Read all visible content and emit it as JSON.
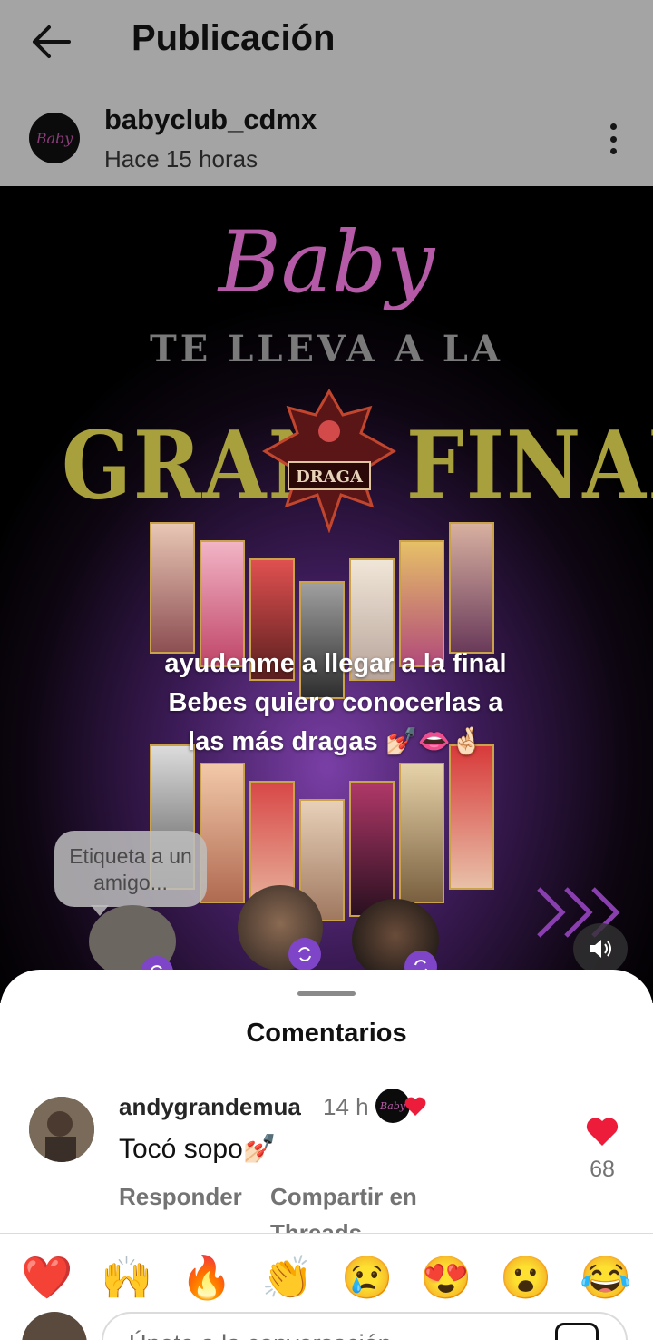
{
  "header": {
    "title": "Publicación",
    "back_icon": "arrow-left-icon",
    "more_icon": "more-vertical-icon"
  },
  "post": {
    "author": "babyclub_cdmx",
    "author_avatar_text": "Baby",
    "time": "Hace 15 horas",
    "image": {
      "brand_script": "Baby",
      "line1": "TE LLEVA A LA",
      "gran": "GRAN",
      "final": "FINAL",
      "emblem_text": "DRAGA",
      "caption": "ayudenme a llegar a la final Bebes quiero conocerlas a las más dragas 💅🏻👄🤞🏻",
      "tag_hint": "Etiqueta a un amigo...",
      "accent_colors": {
        "script": "#b55aa6",
        "gold": "#a8a03c",
        "purple": "#7f45c9"
      }
    }
  },
  "comments": {
    "title": "Comentarios",
    "items": [
      {
        "user": "andygrandemua",
        "time": "14 h",
        "creator_liked_text": "Baby",
        "text": "Tocó sopo💅🏻",
        "reply_label": "Responder",
        "share_label": "Compartir en Threads",
        "likes": "68"
      }
    ]
  },
  "reactions": [
    "❤️",
    "🙌",
    "🔥",
    "👏",
    "😢",
    "😍",
    "😮",
    "😂"
  ],
  "composer": {
    "placeholder": "Únete a la conversación..."
  }
}
